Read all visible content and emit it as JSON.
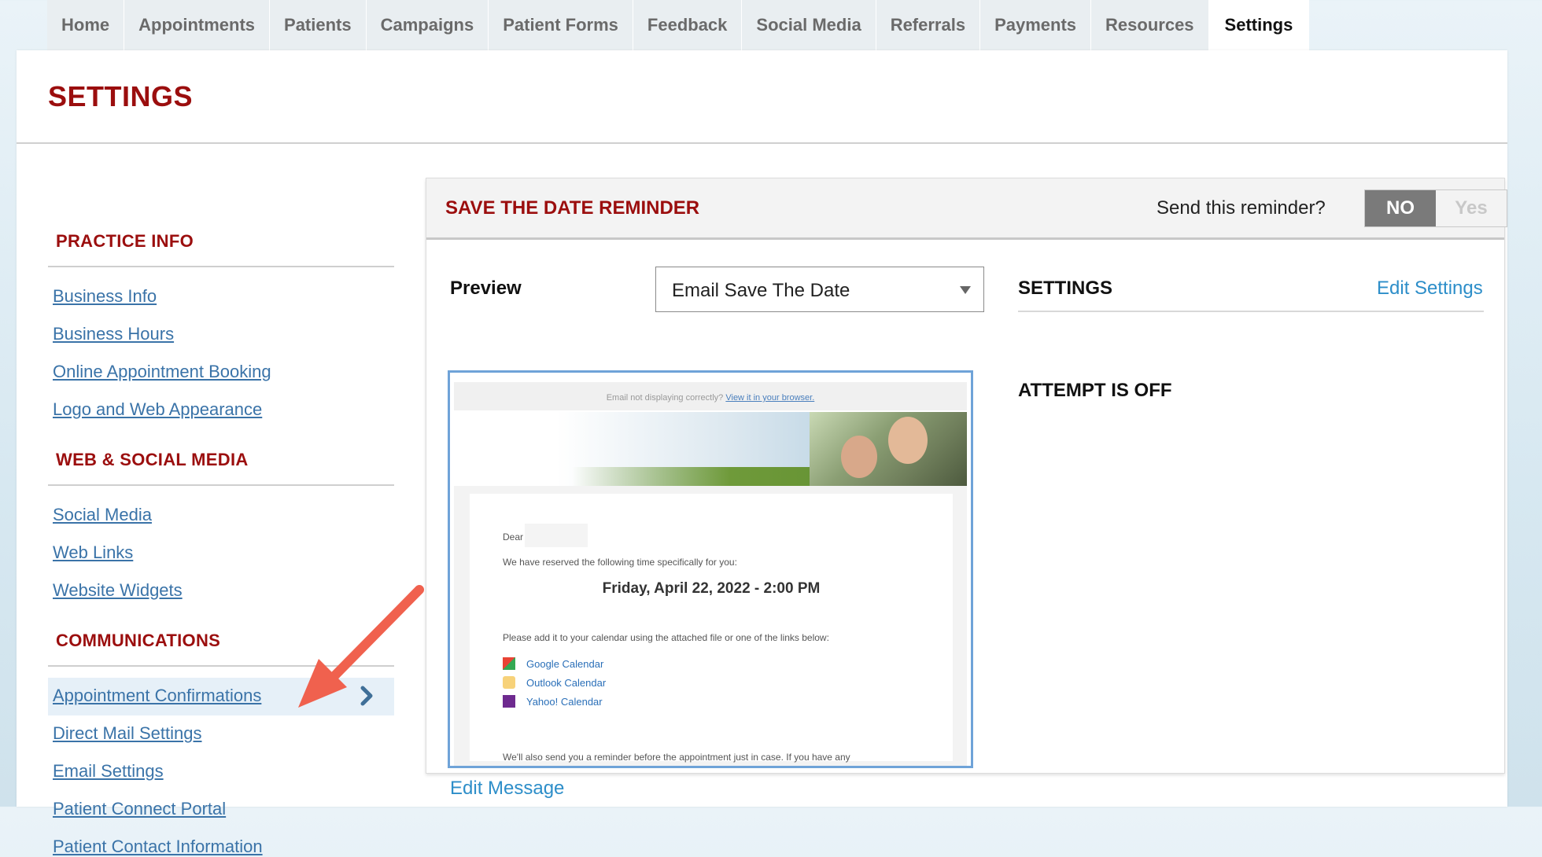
{
  "nav": {
    "tabs": [
      {
        "label": "Home"
      },
      {
        "label": "Appointments"
      },
      {
        "label": "Patients"
      },
      {
        "label": "Campaigns"
      },
      {
        "label": "Patient Forms"
      },
      {
        "label": "Feedback"
      },
      {
        "label": "Social Media"
      },
      {
        "label": "Referrals"
      },
      {
        "label": "Payments"
      },
      {
        "label": "Resources"
      },
      {
        "label": "Settings"
      }
    ],
    "active": "Settings"
  },
  "page": {
    "title": "SETTINGS"
  },
  "sidebar": {
    "practice_info": {
      "heading": "PRACTICE INFO",
      "links": [
        "Business Info",
        "Business Hours",
        "Online Appointment Booking",
        "Logo and Web Appearance"
      ]
    },
    "web_social": {
      "heading": "WEB & SOCIAL MEDIA",
      "links": [
        "Social Media",
        "Web Links",
        "Website Widgets"
      ]
    },
    "communications": {
      "heading": "COMMUNICATIONS",
      "links": [
        "Appointment Confirmations",
        "Direct Mail Settings",
        "Email Settings",
        "Patient Connect Portal",
        "Patient Contact Information"
      ]
    }
  },
  "reminder": {
    "title": "SAVE THE DATE REMINDER",
    "send_question": "Send this reminder?",
    "toggle_no": "NO",
    "toggle_yes": "Yes",
    "preview_label": "Preview",
    "preview_select": "Email Save The Date",
    "email": {
      "not_displaying": "Email not displaying correctly?",
      "view_link": "View it in your browser.",
      "dear": "Dear",
      "reserved_line": "We have reserved the following time specifically for you:",
      "date": "Friday, April 22, 2022 - 2:00 PM",
      "add_line": "Please add it to your calendar using the attached file or one of the links below:",
      "calendars": [
        "Google Calendar",
        "Outlook Calendar",
        "Yahoo! Calendar"
      ],
      "reminder_line": "We'll also send you a reminder before the appointment just in case. If you have any"
    },
    "edit_message": "Edit Message",
    "settings_heading": "SETTINGS",
    "edit_settings": "Edit Settings",
    "status": "ATTEMPT IS OFF"
  },
  "colors": {
    "brand_red": "#9b0e0e",
    "link_blue": "#3a73a8",
    "action_blue": "#2d8ec9",
    "arrow": "#f0614e"
  }
}
